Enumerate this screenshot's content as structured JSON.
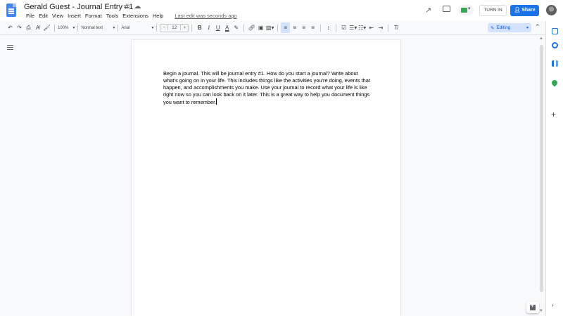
{
  "document": {
    "title": "Gerald Guest - Journal Entry #1",
    "title_icons": [
      "star-icon",
      "folder-icon",
      "cloud-saved-icon"
    ],
    "body_text": "Begin a journal. This will be journal entry #1. How do you start a journal? Write about what's going on in your life. This includes things like the activities you're doing, events that happen, and accomplishments you make. Use your journal to record what your life is like right now so you can look back on it later. This is a great way to help you document things you want to remember."
  },
  "menubar": {
    "items": [
      "File",
      "Edit",
      "View",
      "Insert",
      "Format",
      "Tools",
      "Extensions",
      "Help"
    ],
    "last_edit": "Last edit was seconds ago"
  },
  "header_actions": {
    "turn_in_label": "TURN IN",
    "share_label": "Share",
    "icons": [
      "activity-trend-icon",
      "comments-icon",
      "meet-icon",
      "account-avatar"
    ]
  },
  "toolbar": {
    "zoom": "100%",
    "style": "Normal text",
    "font": "Arial",
    "font_size": "12",
    "font_size_minus": "−",
    "font_size_plus": "+",
    "mode": "Editing"
  },
  "colors": {
    "accent": "#1a73e8",
    "editing_bg": "#d3e3fd",
    "page_bg": "#f8f9fa"
  },
  "side_panel": {
    "icons": [
      "calendar-icon",
      "keep-icon",
      "tasks-icon",
      "maps-icon",
      "add-icon"
    ]
  }
}
